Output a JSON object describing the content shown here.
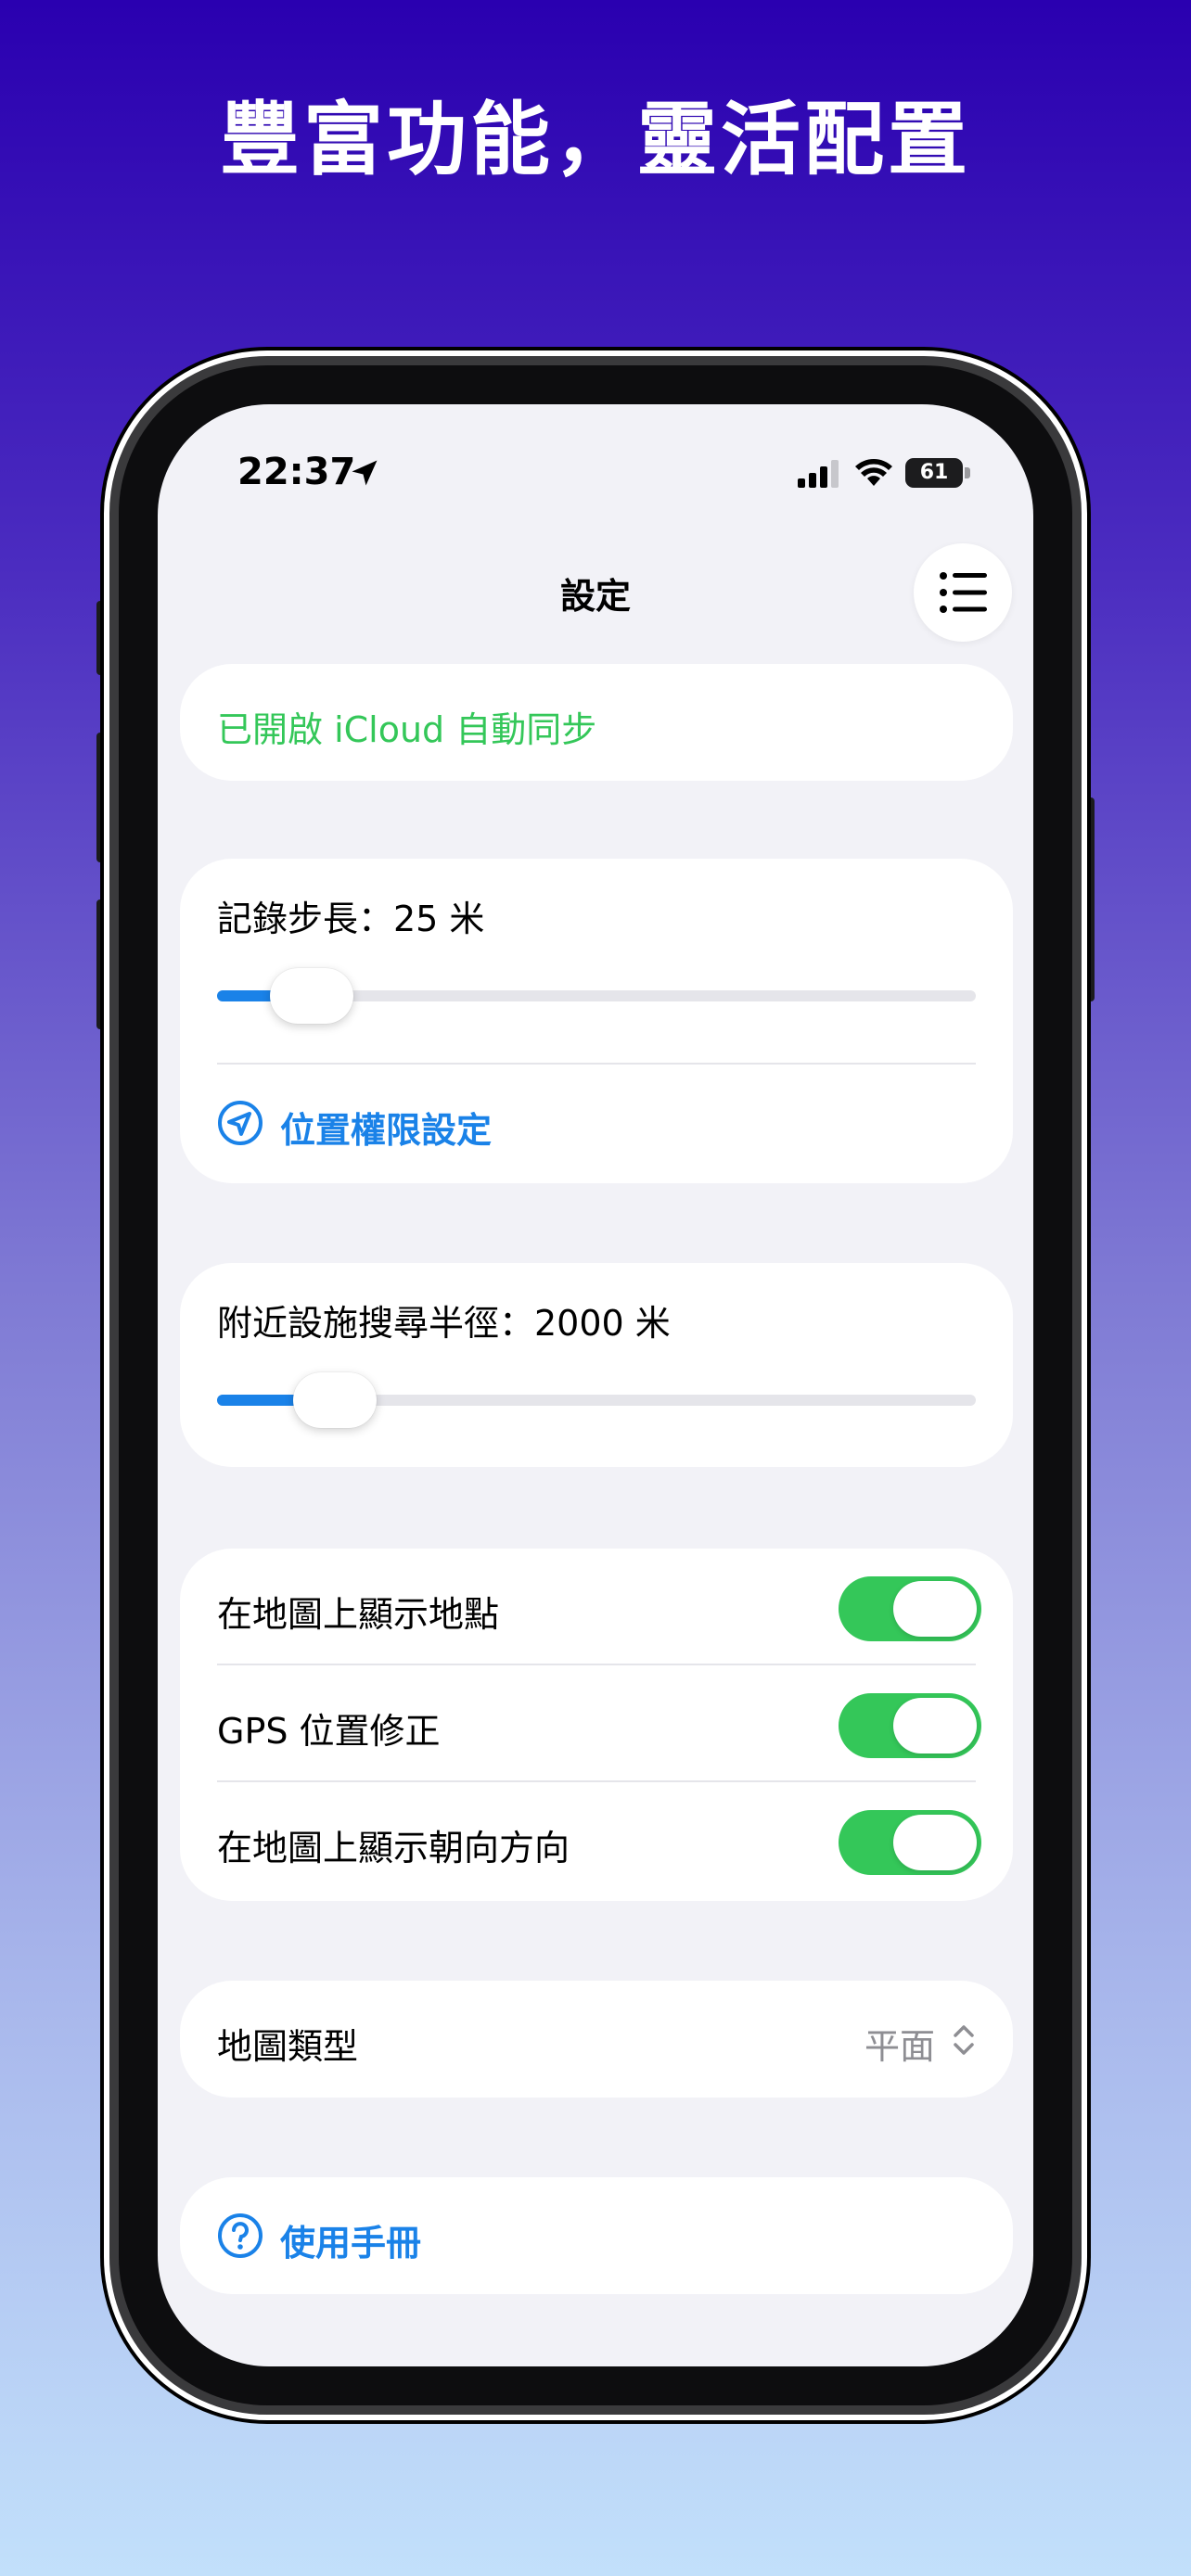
{
  "headline": "豐富功能，靈活配置",
  "status_bar": {
    "time": "22:37",
    "battery": "61",
    "icons": [
      "location-arrow-icon",
      "cellular-signal-icon",
      "wifi-icon",
      "battery-icon"
    ]
  },
  "nav": {
    "title": "設定",
    "menu_icon": "list-icon"
  },
  "icloud": {
    "label": "已開啟 iCloud 自動同步",
    "color": "#34c759"
  },
  "record_step": {
    "label": "記錄步長：25 米",
    "slider_fraction": 0.07,
    "location_permission_label": "位置權限設定"
  },
  "search_radius": {
    "label": "附近設施搜尋半徑：2000 米",
    "slider_fraction": 0.1
  },
  "toggles": [
    {
      "label": "在地圖上顯示地點",
      "on": true
    },
    {
      "label": "GPS 位置修正",
      "on": true
    },
    {
      "label": "在地圖上顯示朝向方向",
      "on": true
    }
  ],
  "map_type": {
    "label": "地圖類型",
    "value": "平面"
  },
  "manual": {
    "label": "使用手冊"
  },
  "colors": {
    "accent": "#1a82e8",
    "green": "#34c759",
    "background": "#f2f2f7"
  }
}
